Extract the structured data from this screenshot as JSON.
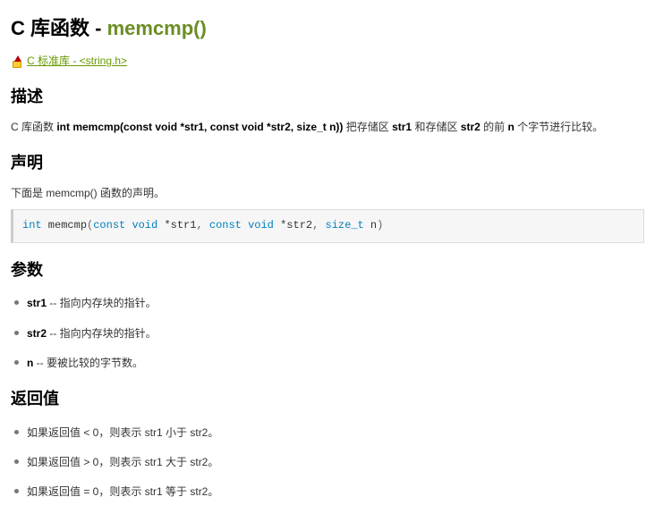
{
  "title": {
    "prefix": "C 库函数 - ",
    "name": "memcmp()"
  },
  "navlink": "C 标准库 - <string.h>",
  "sections": {
    "description": {
      "heading": "描述",
      "text_prefix": "C 库函数 ",
      "signature_bold": "int memcmp(const void *str1, const void *str2, size_t n))",
      "text_mid1": " 把存储区 ",
      "p_str1": "str1",
      "text_mid2": " 和存储区 ",
      "p_str2": "str2",
      "text_mid3": " 的前 ",
      "p_n": "n",
      "text_suffix": " 个字节进行比较。"
    },
    "declaration": {
      "heading": "声明",
      "intro": "下面是 memcmp() 函数的声明。",
      "code_prefix": "int",
      "code_func": " memcmp",
      "code_open": "(",
      "code_param_kw1": "const void",
      "code_param1": " *str1",
      "code_comma1": ",",
      "code_param_kw2": " const void",
      "code_param2": " *str2",
      "code_comma2": ",",
      "code_param_kw3": " size_t",
      "code_param3": " n",
      "code_close": ")"
    },
    "params": {
      "heading": "参数",
      "items": [
        {
          "name": "str1",
          "desc": " -- 指向内存块的指针。"
        },
        {
          "name": "str2",
          "desc": " -- 指向内存块的指针。"
        },
        {
          "name": "n",
          "desc": " -- 要被比较的字节数。"
        }
      ]
    },
    "returns": {
      "heading": "返回值",
      "items": [
        "如果返回值 < 0，则表示 str1 小于 str2。",
        "如果返回值 > 0，则表示 str1 大于 str2。",
        "如果返回值 = 0，则表示 str1 等于 str2。"
      ]
    }
  }
}
